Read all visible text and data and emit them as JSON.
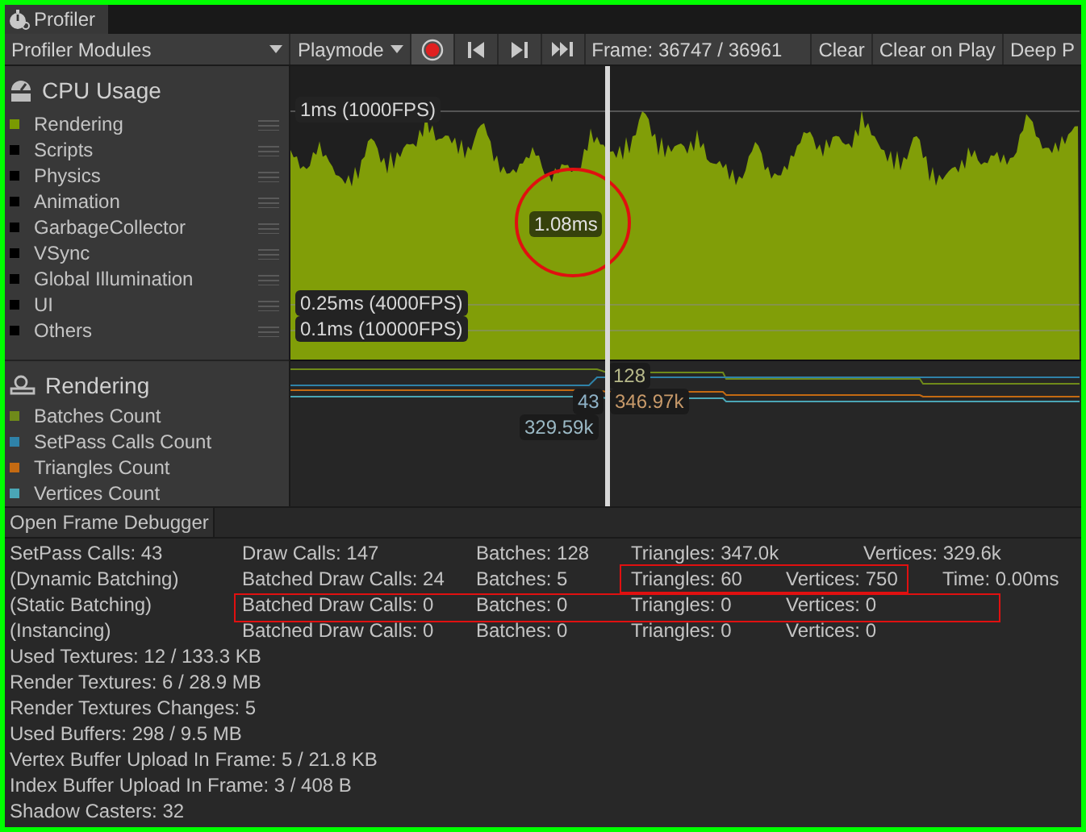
{
  "window": {
    "tab": "Profiler"
  },
  "toolbar": {
    "modules_dropdown": "Profiler Modules",
    "mode_dropdown": "Playmode",
    "record": {
      "on": true
    },
    "frame": "Frame: 36747 / 36961",
    "buttons": [
      "Clear",
      "Clear on Play",
      "Deep P"
    ]
  },
  "cpu_module": {
    "title": "CPU Usage",
    "legend": [
      {
        "label": "Rendering",
        "color": "#7a9a01"
      },
      {
        "label": "Scripts",
        "color": "#000000"
      },
      {
        "label": "Physics",
        "color": "#000000"
      },
      {
        "label": "Animation",
        "color": "#000000"
      },
      {
        "label": "GarbageCollector",
        "color": "#000000"
      },
      {
        "label": "VSync",
        "color": "#000000"
      },
      {
        "label": "Global Illumination",
        "color": "#000000"
      },
      {
        "label": "UI",
        "color": "#000000"
      },
      {
        "label": "Others",
        "color": "#000000"
      }
    ],
    "thresholds": [
      "1ms (1000FPS)",
      "0.25ms (4000FPS)",
      "0.1ms (10000FPS)"
    ],
    "selected_value": "1.08ms"
  },
  "rendering_module": {
    "title": "Rendering",
    "legend": [
      {
        "label": "Batches Count",
        "color": "#6f8a1a"
      },
      {
        "label": "SetPass Calls Count",
        "color": "#2f82a8"
      },
      {
        "label": "Triangles Count",
        "color": "#c46a12"
      },
      {
        "label": "Vertices Count",
        "color": "#4aa6b6"
      }
    ],
    "value_labels": [
      "128",
      "43",
      "346.97k",
      "329.59k"
    ]
  },
  "details": {
    "button": "Open Frame Debugger",
    "table_rows": [
      {
        "kind": "summary",
        "cells": [
          "SetPass Calls: 43",
          "Draw Calls: 147",
          "Batches: 128",
          "Triangles: 347.0k",
          "Vertices: 329.6k"
        ]
      },
      {
        "kind": "batching",
        "cells": [
          "(Dynamic Batching)",
          "Batched Draw Calls: 24",
          "Batches: 5",
          "Triangles: 60",
          "Vertices: 750",
          "Time: 0.00ms"
        ]
      },
      {
        "kind": "batching",
        "cells": [
          "(Static Batching)",
          "Batched Draw Calls: 0",
          "Batches: 0",
          "Triangles: 0",
          "Vertices: 0"
        ]
      },
      {
        "kind": "batching",
        "cells": [
          "(Instancing)",
          "Batched Draw Calls: 0",
          "Batches: 0",
          "Triangles: 0",
          "Vertices: 0"
        ]
      }
    ],
    "lines": [
      "Used Textures: 12 / 133.3 KB",
      "Render Textures: 6 / 28.9 MB",
      "Render Textures Changes: 5",
      "Used Buffers: 298 / 9.5 MB",
      "Vertex Buffer Upload In Frame: 5 / 21.8 KB",
      "Index Buffer Upload In Frame: 3 / 408 B",
      "Shadow Casters: 32"
    ]
  }
}
